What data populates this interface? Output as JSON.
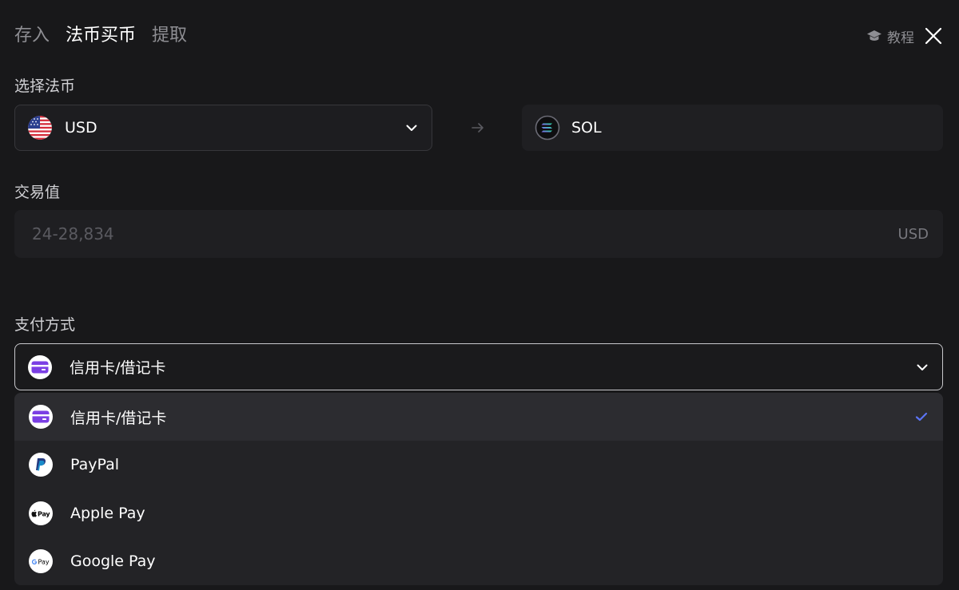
{
  "header": {
    "tabs": [
      {
        "label": "存入",
        "active": false
      },
      {
        "label": "法币买币",
        "active": true
      },
      {
        "label": "提取",
        "active": false
      }
    ],
    "tutorial_label": "教程"
  },
  "fiat": {
    "label": "选择法币",
    "selected_code": "USD",
    "selected_icon": "us-flag-icon"
  },
  "crypto": {
    "code": "SOL",
    "icon": "solana-icon"
  },
  "amount": {
    "label": "交易值",
    "placeholder": "24-28,834",
    "value": "",
    "unit": "USD"
  },
  "payment": {
    "label": "支付方式",
    "selected_label": "信用卡/借记卡",
    "options": [
      {
        "label": "信用卡/借记卡",
        "icon": "card-icon",
        "selected": true
      },
      {
        "label": "PayPal",
        "icon": "paypal-icon",
        "selected": false
      },
      {
        "label": "Apple Pay",
        "icon": "apple-pay-icon",
        "selected": false
      },
      {
        "label": "Google Pay",
        "icon": "google-pay-icon",
        "selected": false
      }
    ]
  },
  "colors": {
    "background": "#18181a",
    "accent_purple": "#7b3fe4",
    "check_blue": "#5b74f5",
    "muted_text": "#8e8e93"
  }
}
